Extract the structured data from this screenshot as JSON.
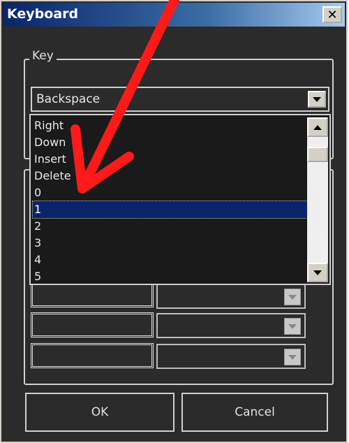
{
  "window": {
    "title": "Keyboard"
  },
  "key_group": {
    "label": "Key"
  },
  "key_combo": {
    "selected": "Backspace"
  },
  "dropdown_list": {
    "items": [
      "Right",
      "Down",
      "Insert",
      "Delete",
      "0",
      "1",
      "2",
      "3",
      "4",
      "5"
    ],
    "selected_item": "1"
  },
  "buttons": {
    "ok": "OK",
    "cancel": "Cancel"
  },
  "colors": {
    "annotation_arrow": "#ff1a1a",
    "selection": "#0a246a"
  }
}
